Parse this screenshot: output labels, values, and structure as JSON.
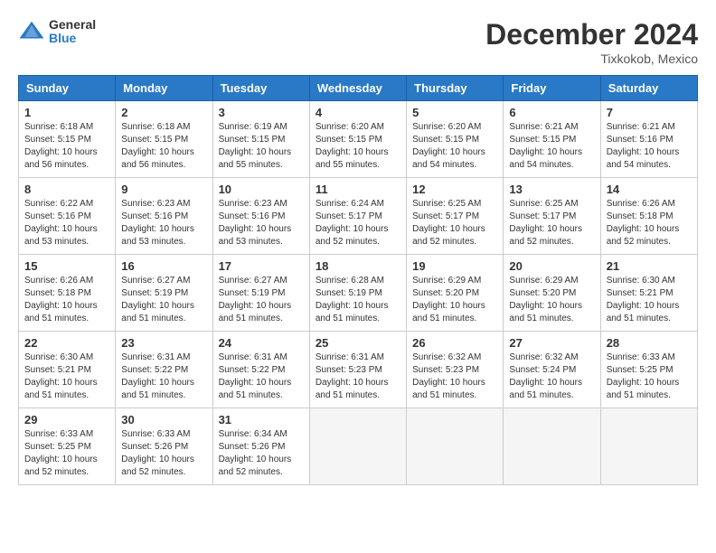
{
  "header": {
    "logo_general": "General",
    "logo_blue": "Blue",
    "month_year": "December 2024",
    "location": "Tixkokob, Mexico"
  },
  "calendar": {
    "days_of_week": [
      "Sunday",
      "Monday",
      "Tuesday",
      "Wednesday",
      "Thursday",
      "Friday",
      "Saturday"
    ],
    "weeks": [
      [
        {
          "day": "",
          "info": ""
        },
        {
          "day": "2",
          "info": "Sunrise: 6:18 AM\nSunset: 5:15 PM\nDaylight: 10 hours\nand 56 minutes."
        },
        {
          "day": "3",
          "info": "Sunrise: 6:19 AM\nSunset: 5:15 PM\nDaylight: 10 hours\nand 55 minutes."
        },
        {
          "day": "4",
          "info": "Sunrise: 6:20 AM\nSunset: 5:15 PM\nDaylight: 10 hours\nand 55 minutes."
        },
        {
          "day": "5",
          "info": "Sunrise: 6:20 AM\nSunset: 5:15 PM\nDaylight: 10 hours\nand 54 minutes."
        },
        {
          "day": "6",
          "info": "Sunrise: 6:21 AM\nSunset: 5:15 PM\nDaylight: 10 hours\nand 54 minutes."
        },
        {
          "day": "7",
          "info": "Sunrise: 6:21 AM\nSunset: 5:16 PM\nDaylight: 10 hours\nand 54 minutes."
        }
      ],
      [
        {
          "day": "8",
          "info": "Sunrise: 6:22 AM\nSunset: 5:16 PM\nDaylight: 10 hours\nand 53 minutes."
        },
        {
          "day": "9",
          "info": "Sunrise: 6:23 AM\nSunset: 5:16 PM\nDaylight: 10 hours\nand 53 minutes."
        },
        {
          "day": "10",
          "info": "Sunrise: 6:23 AM\nSunset: 5:16 PM\nDaylight: 10 hours\nand 53 minutes."
        },
        {
          "day": "11",
          "info": "Sunrise: 6:24 AM\nSunset: 5:17 PM\nDaylight: 10 hours\nand 52 minutes."
        },
        {
          "day": "12",
          "info": "Sunrise: 6:25 AM\nSunset: 5:17 PM\nDaylight: 10 hours\nand 52 minutes."
        },
        {
          "day": "13",
          "info": "Sunrise: 6:25 AM\nSunset: 5:17 PM\nDaylight: 10 hours\nand 52 minutes."
        },
        {
          "day": "14",
          "info": "Sunrise: 6:26 AM\nSunset: 5:18 PM\nDaylight: 10 hours\nand 52 minutes."
        }
      ],
      [
        {
          "day": "15",
          "info": "Sunrise: 6:26 AM\nSunset: 5:18 PM\nDaylight: 10 hours\nand 51 minutes."
        },
        {
          "day": "16",
          "info": "Sunrise: 6:27 AM\nSunset: 5:19 PM\nDaylight: 10 hours\nand 51 minutes."
        },
        {
          "day": "17",
          "info": "Sunrise: 6:27 AM\nSunset: 5:19 PM\nDaylight: 10 hours\nand 51 minutes."
        },
        {
          "day": "18",
          "info": "Sunrise: 6:28 AM\nSunset: 5:19 PM\nDaylight: 10 hours\nand 51 minutes."
        },
        {
          "day": "19",
          "info": "Sunrise: 6:29 AM\nSunset: 5:20 PM\nDaylight: 10 hours\nand 51 minutes."
        },
        {
          "day": "20",
          "info": "Sunrise: 6:29 AM\nSunset: 5:20 PM\nDaylight: 10 hours\nand 51 minutes."
        },
        {
          "day": "21",
          "info": "Sunrise: 6:30 AM\nSunset: 5:21 PM\nDaylight: 10 hours\nand 51 minutes."
        }
      ],
      [
        {
          "day": "22",
          "info": "Sunrise: 6:30 AM\nSunset: 5:21 PM\nDaylight: 10 hours\nand 51 minutes."
        },
        {
          "day": "23",
          "info": "Sunrise: 6:31 AM\nSunset: 5:22 PM\nDaylight: 10 hours\nand 51 minutes."
        },
        {
          "day": "24",
          "info": "Sunrise: 6:31 AM\nSunset: 5:22 PM\nDaylight: 10 hours\nand 51 minutes."
        },
        {
          "day": "25",
          "info": "Sunrise: 6:31 AM\nSunset: 5:23 PM\nDaylight: 10 hours\nand 51 minutes."
        },
        {
          "day": "26",
          "info": "Sunrise: 6:32 AM\nSunset: 5:23 PM\nDaylight: 10 hours\nand 51 minutes."
        },
        {
          "day": "27",
          "info": "Sunrise: 6:32 AM\nSunset: 5:24 PM\nDaylight: 10 hours\nand 51 minutes."
        },
        {
          "day": "28",
          "info": "Sunrise: 6:33 AM\nSunset: 5:25 PM\nDaylight: 10 hours\nand 51 minutes."
        }
      ],
      [
        {
          "day": "29",
          "info": "Sunrise: 6:33 AM\nSunset: 5:25 PM\nDaylight: 10 hours\nand 52 minutes."
        },
        {
          "day": "30",
          "info": "Sunrise: 6:33 AM\nSunset: 5:26 PM\nDaylight: 10 hours\nand 52 minutes."
        },
        {
          "day": "31",
          "info": "Sunrise: 6:34 AM\nSunset: 5:26 PM\nDaylight: 10 hours\nand 52 minutes."
        },
        {
          "day": "",
          "info": ""
        },
        {
          "day": "",
          "info": ""
        },
        {
          "day": "",
          "info": ""
        },
        {
          "day": "",
          "info": ""
        }
      ]
    ],
    "week1_day1": {
      "day": "1",
      "info": "Sunrise: 6:18 AM\nSunset: 5:15 PM\nDaylight: 10 hours\nand 56 minutes."
    }
  }
}
